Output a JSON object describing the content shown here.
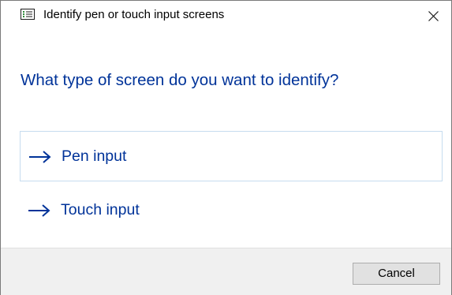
{
  "window": {
    "title": "Identify pen or touch input screens",
    "title_icon": "calibration-list-icon",
    "close_icon": "close-icon"
  },
  "main": {
    "heading": "What type of screen do you want to identify?",
    "options": [
      {
        "label": "Pen input",
        "icon": "arrow-right-icon",
        "highlighted": true
      },
      {
        "label": "Touch input",
        "icon": "arrow-right-icon",
        "highlighted": false
      }
    ]
  },
  "footer": {
    "cancel_label": "Cancel"
  },
  "colors": {
    "link": "#003399",
    "highlight_border": "#c6dcef",
    "footer_bg": "#f0f0f0",
    "button_bg": "#e1e1e1"
  }
}
